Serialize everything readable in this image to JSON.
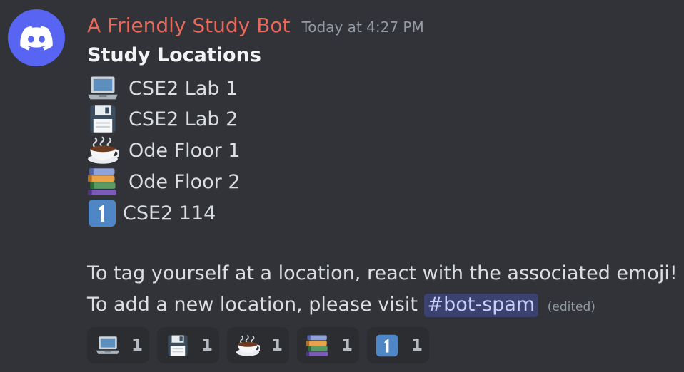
{
  "author": {
    "name": "A Friendly Study Bot",
    "timestamp": "Today at 4:27 PM",
    "avatar_icon": "discord-logo-icon",
    "name_color": "#e8695a",
    "avatar_color": "#5865f2"
  },
  "message": {
    "title": "Study Locations",
    "locations": [
      {
        "emoji": "laptop-icon",
        "label": "CSE2 Lab 1"
      },
      {
        "emoji": "floppy-disk-icon",
        "label": "CSE2 Lab 2"
      },
      {
        "emoji": "hot-beverage-icon",
        "label": "Ode Floor 1"
      },
      {
        "emoji": "books-icon",
        "label": "Ode Floor 2"
      },
      {
        "emoji": "keycap-1-icon",
        "label": "CSE2 114"
      }
    ],
    "instruction": "To tag yourself at a location, react with the associated emoji!",
    "add_prefix": "To add a new location, please visit",
    "channel_mention": "#bot-spam",
    "edited_label": "(edited)"
  },
  "reactions": [
    {
      "emoji": "laptop-icon",
      "count": "1"
    },
    {
      "emoji": "floppy-disk-icon",
      "count": "1"
    },
    {
      "emoji": "hot-beverage-icon",
      "count": "1"
    },
    {
      "emoji": "books-icon",
      "count": "1"
    },
    {
      "emoji": "keycap-1-icon",
      "count": "1"
    }
  ],
  "colors": {
    "background": "#313338",
    "mention_bg": "#3c4270",
    "mention_text": "#c9cdfb"
  }
}
